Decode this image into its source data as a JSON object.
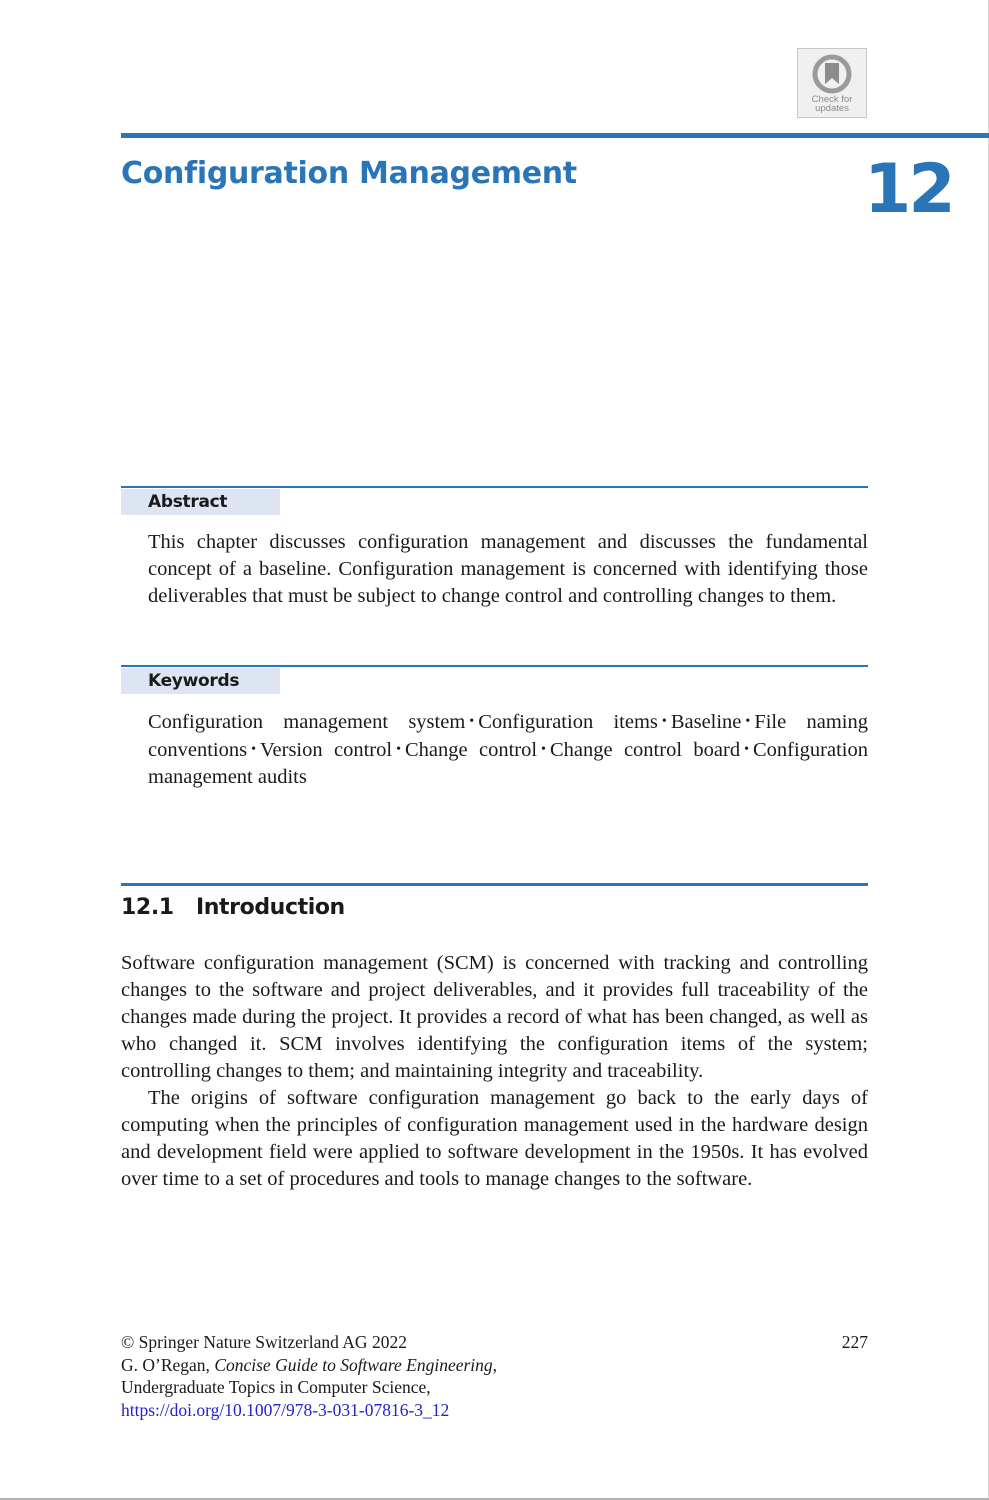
{
  "badge": {
    "line1": "Check for",
    "line2": "updates"
  },
  "chapter": {
    "title": "Configuration Management",
    "number": "12"
  },
  "abstract": {
    "label": "Abstract",
    "text": "This chapter discusses configuration management and discusses the fundamental concept of a baseline. Configuration management is concerned with identifying those deliverables that must be subject to change control and controlling changes to them."
  },
  "keywords": {
    "label": "Keywords",
    "separator": "•",
    "items": [
      "Configuration management system",
      "Configuration items",
      "Baseline",
      "File naming conventions",
      "Version control",
      "Change control",
      "Change control board",
      "Configuration management audits"
    ]
  },
  "section": {
    "number": "12.1",
    "title": "Introduction",
    "paragraphs": [
      "Software configuration management (SCM) is concerned with tracking and controlling changes to the software and project deliverables, and it provides full traceability of the changes made during the project. It provides a record of what has been changed, as well as who changed it. SCM involves identifying the configuration items of the system; controlling changes to them; and maintaining integrity and traceability.",
      "The origins of software configuration management go back to the early days of computing when the principles of configuration management used in the hardware design and development field were applied to software development in the 1950s. It has evolved over time to a set of procedures and tools to manage changes to the software."
    ]
  },
  "footer": {
    "copyright": "© Springer Nature Switzerland AG 2022",
    "author": "G. O’Regan, ",
    "book_title": "Concise Guide to Software Engineering",
    "book_suffix": ",",
    "series": "Undergraduate Topics in Computer Science,",
    "doi": "https://doi.org/10.1007/978-3-031-07816-3_12",
    "page_number": "227"
  },
  "colors": {
    "accent": "#2a75b8",
    "label_background": "#dde4f2",
    "link": "#2323cc"
  }
}
